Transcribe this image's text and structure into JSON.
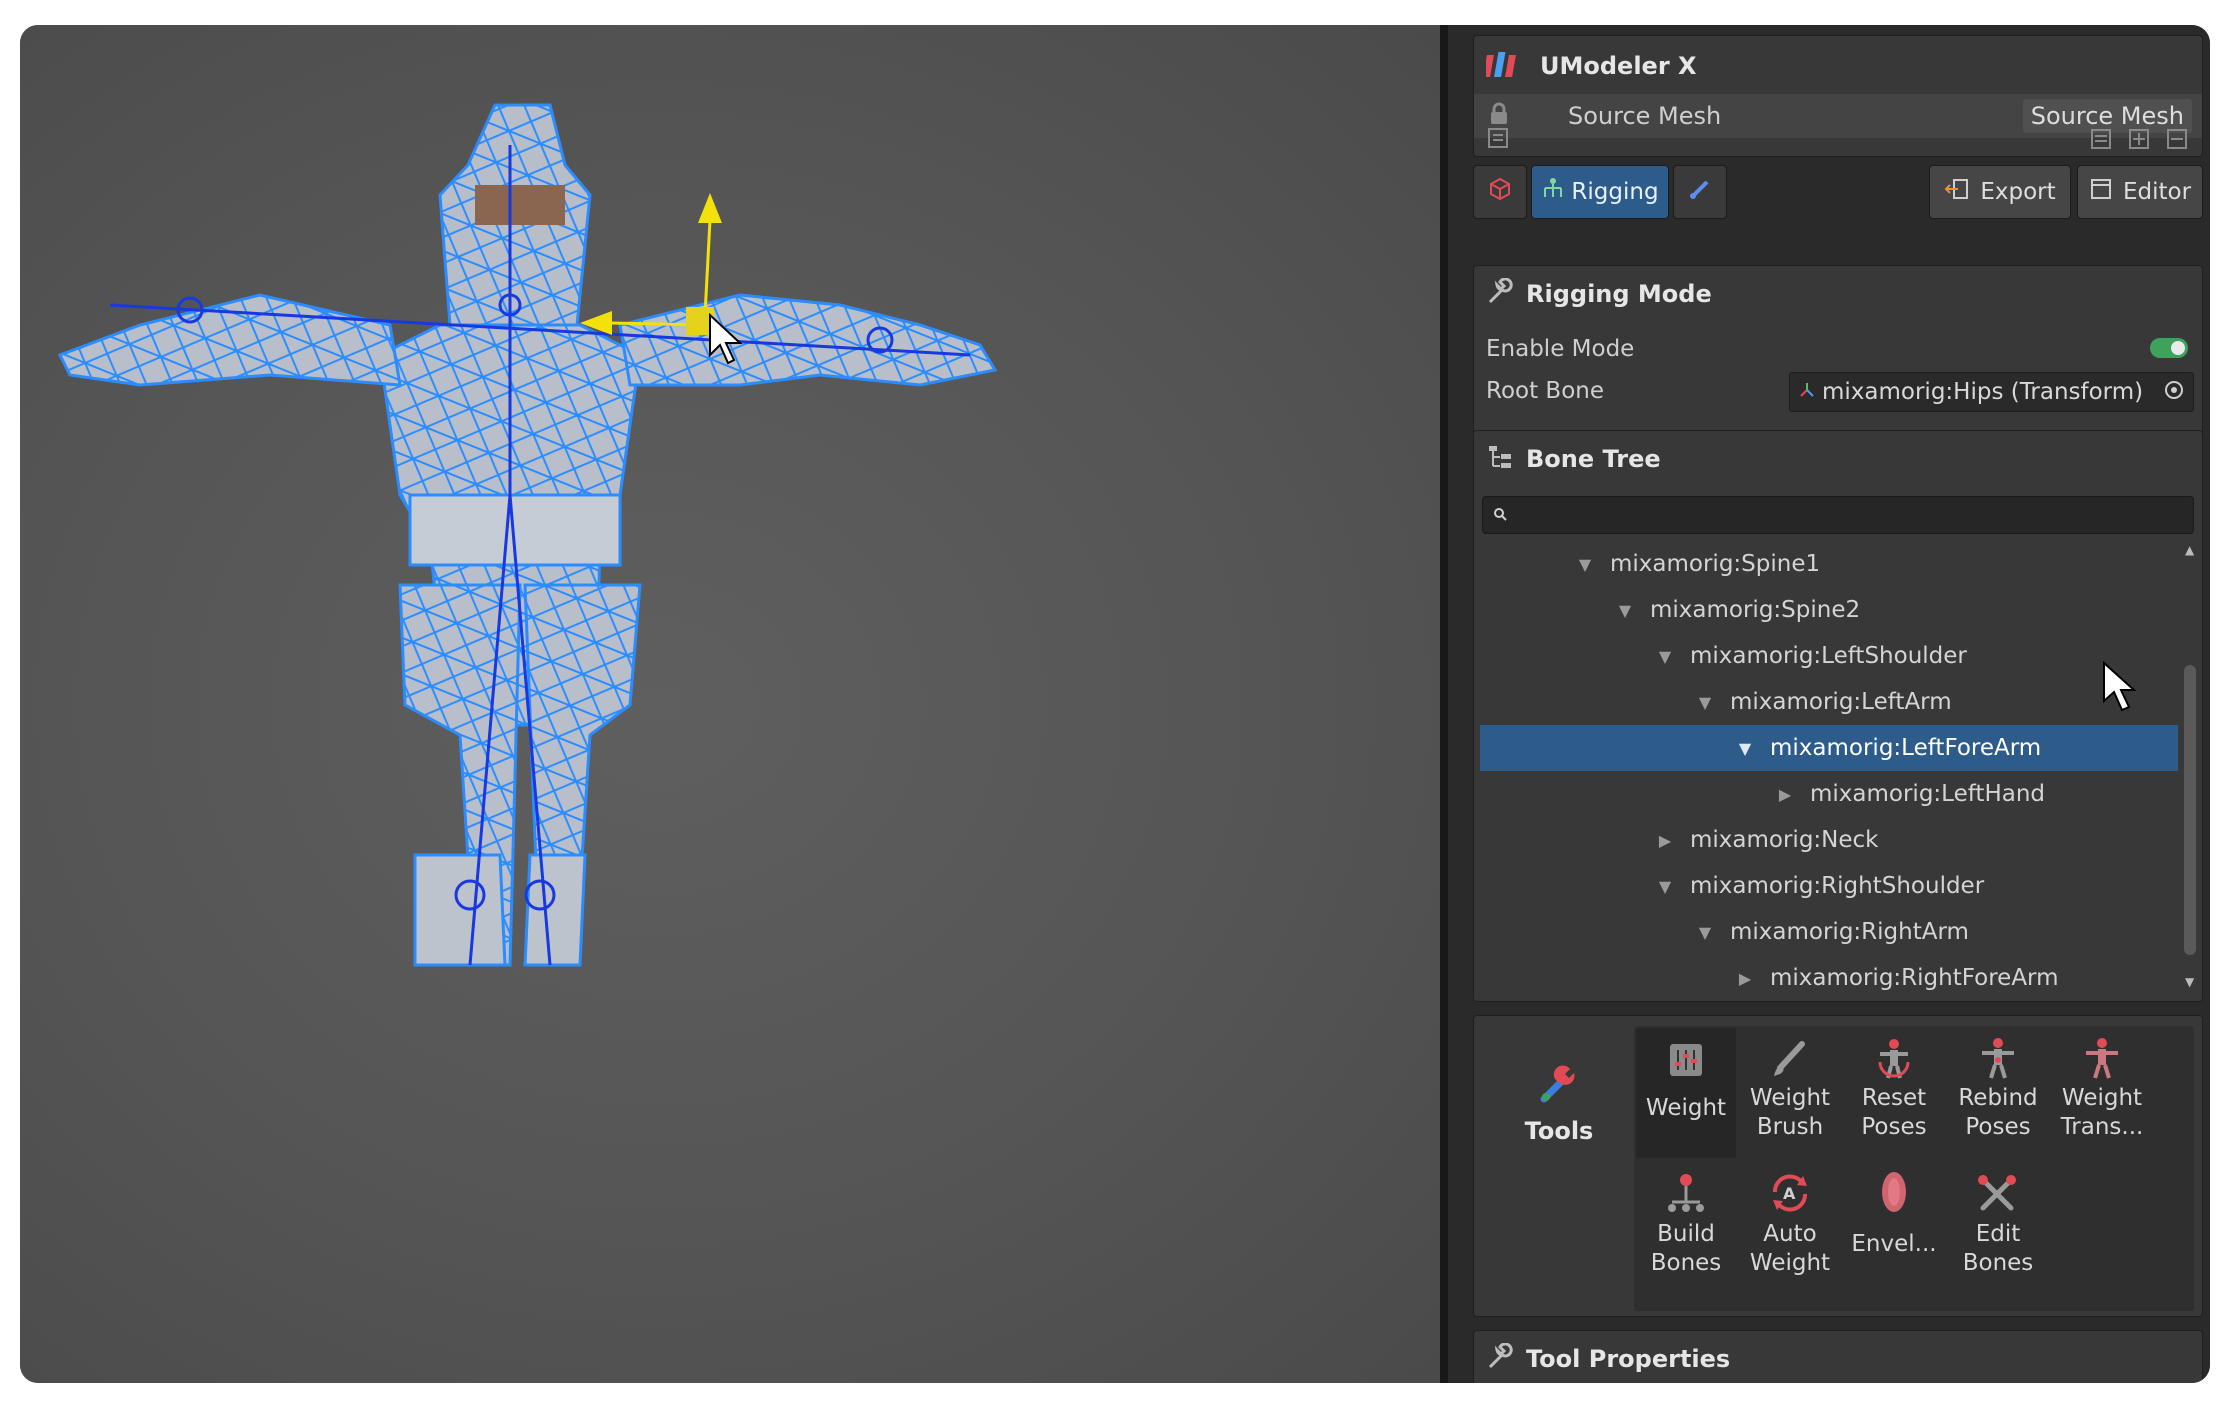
{
  "app": {
    "title": "UModeler X"
  },
  "source_mesh": {
    "label": "Source Mesh",
    "value": "Source Mesh"
  },
  "tabs": {
    "rigging": "Rigging",
    "export": "Export",
    "editor": "Editor"
  },
  "rigging_mode": {
    "title": "Rigging Mode",
    "enable_label": "Enable Mode",
    "enable_on": true,
    "root_bone_label": "Root Bone",
    "root_bone_value": "mixamorig:Hips (Transform)"
  },
  "bone_tree": {
    "title": "Bone Tree",
    "search_value": "",
    "items": [
      {
        "label": "mixamorig:Spine1",
        "expanded": true,
        "selected": false
      },
      {
        "label": "mixamorig:Spine2",
        "expanded": true,
        "selected": false
      },
      {
        "label": "mixamorig:LeftShoulder",
        "expanded": true,
        "selected": false
      },
      {
        "label": "mixamorig:LeftArm",
        "expanded": true,
        "selected": false
      },
      {
        "label": "mixamorig:LeftForeArm",
        "expanded": true,
        "selected": true
      },
      {
        "label": "mixamorig:LeftHand",
        "expanded": false,
        "selected": false
      },
      {
        "label": "mixamorig:Neck",
        "expanded": false,
        "selected": false
      },
      {
        "label": "mixamorig:RightShoulder",
        "expanded": true,
        "selected": false
      },
      {
        "label": "mixamorig:RightArm",
        "expanded": true,
        "selected": false
      },
      {
        "label": "mixamorig:RightForeArm",
        "expanded": false,
        "selected": false
      }
    ]
  },
  "tools": {
    "title": "Tools",
    "items": [
      {
        "line1": "Weight",
        "line2": "",
        "icon": "weight-icon",
        "active": true
      },
      {
        "line1": "Weight",
        "line2": "Brush",
        "icon": "brush-icon",
        "active": false
      },
      {
        "line1": "Reset",
        "line2": "Poses",
        "icon": "reset-poses-icon",
        "active": false
      },
      {
        "line1": "Rebind",
        "line2": "Poses",
        "icon": "rebind-poses-icon",
        "active": false
      },
      {
        "line1": "Weight",
        "line2": "Trans...",
        "icon": "weight-transfer-icon",
        "active": false
      },
      {
        "line1": "Build",
        "line2": "Bones",
        "icon": "build-bones-icon",
        "active": false
      },
      {
        "line1": "Auto",
        "line2": "Weight",
        "icon": "auto-weight-icon",
        "active": false
      },
      {
        "line1": "Envel...",
        "line2": "",
        "icon": "envelope-icon",
        "active": false
      },
      {
        "line1": "Edit",
        "line2": "Bones",
        "icon": "edit-bones-icon",
        "active": false
      }
    ]
  },
  "tool_properties": {
    "title": "Tool Properties"
  },
  "colors": {
    "accent": "#2d5b8a",
    "toggle_on": "#3ea35a",
    "wire": "#2a8cff",
    "gizmo_yellow": "#f2e20a",
    "brand_red": "#e24b55"
  }
}
